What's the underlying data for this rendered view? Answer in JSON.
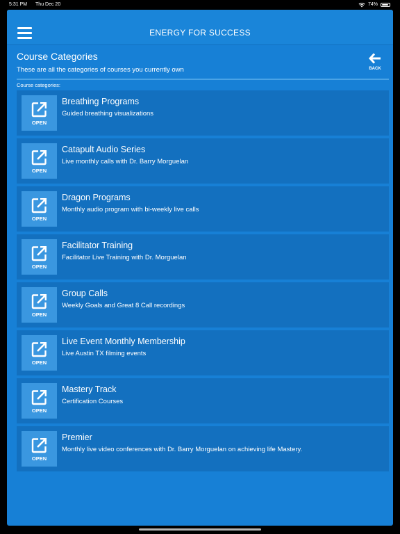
{
  "status_bar": {
    "time": "5:31 PM",
    "date": "Thu Dec 20",
    "battery_text": "74%",
    "battery_level": 0.74,
    "wifi_icon": "wifi-icon",
    "battery_icon": "battery-icon"
  },
  "nav": {
    "title": "ENERGY FOR SUCCESS",
    "menu_icon": "hamburger-menu-icon"
  },
  "header": {
    "title": "Course Categories",
    "subtitle": "These are all the categories of courses you currently own",
    "back_label": "BACK",
    "back_icon": "arrow-left-icon"
  },
  "section_label": "Course categories:",
  "items": [
    {
      "title": "Breathing Programs",
      "description": "Guided breathing visualizations",
      "open_label": "OPEN",
      "icon": "external-link-icon"
    },
    {
      "title": "Catapult Audio Series",
      "description": "Live monthly calls with Dr. Barry Morguelan",
      "open_label": "OPEN",
      "icon": "external-link-icon"
    },
    {
      "title": "Dragon Programs",
      "description": "Monthly audio program with bi-weekly live calls",
      "open_label": "OPEN",
      "icon": "external-link-icon"
    },
    {
      "title": "Facilitator Training",
      "description": "Facilitator Live Training with Dr. Morguelan",
      "open_label": "OPEN",
      "icon": "external-link-icon"
    },
    {
      "title": "Group Calls",
      "description": "Weekly Goals and Great 8 Call recordings",
      "open_label": "OPEN",
      "icon": "external-link-icon"
    },
    {
      "title": "Live Event Monthly Membership",
      "description": "Live Austin TX filming events",
      "open_label": "OPEN",
      "icon": "external-link-icon"
    },
    {
      "title": "Mastery Track",
      "description": "Certification Courses",
      "open_label": "OPEN",
      "icon": "external-link-icon"
    },
    {
      "title": "Premier",
      "description": "Monthly live video conferences with Dr. Barry Morguelan on achieving life Mastery.",
      "open_label": "OPEN",
      "icon": "external-link-icon"
    }
  ],
  "colors": {
    "background": "#1780d6",
    "item_background": "#1370bf",
    "tile_background": "#3a97e0",
    "text": "#ffffff"
  }
}
